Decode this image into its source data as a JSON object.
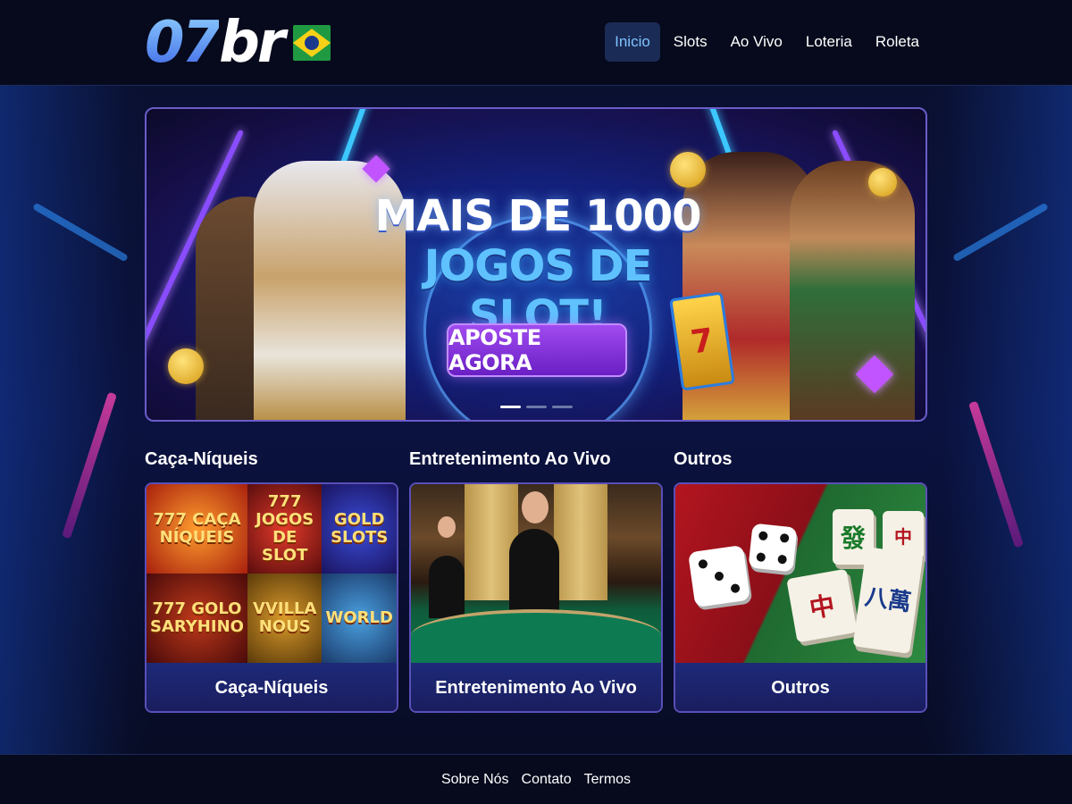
{
  "header": {
    "logo": {
      "part1": "07",
      "part2": "br"
    },
    "nav": [
      {
        "label": "Inicio",
        "active": true
      },
      {
        "label": "Slots",
        "active": false
      },
      {
        "label": "Ao Vivo",
        "active": false
      },
      {
        "label": "Loteria",
        "active": false
      },
      {
        "label": "Roleta",
        "active": false
      }
    ]
  },
  "hero": {
    "line1": "MAIS DE 1000",
    "line2": "JOGOS DE SLOT!",
    "cta": "APOSTE AGORA",
    "slot_card": "7",
    "carousel": {
      "slides": 3,
      "active_index": 0
    }
  },
  "categories": [
    {
      "heading": "Caça-Níqueis",
      "label": "Caça-Níqueis",
      "tiles": [
        "777 CAÇA NÍQUEIS",
        "777 JOGOS DE SLOT",
        "GOLD SLOTS",
        "777 GOLO SARYHINO",
        "VVILLA NOUS",
        "WORLD"
      ]
    },
    {
      "heading": "Entretenimento Ao Vivo",
      "label": "Entretenimento Ao Vivo"
    },
    {
      "heading": "Outros",
      "label": "Outros",
      "mahjong_tiles": [
        "發",
        "八萬",
        "中",
        "中"
      ]
    }
  ],
  "footer": {
    "links": [
      "Sobre Nós",
      "Contato",
      "Termos"
    ]
  },
  "colors": {
    "background": "#070b1e",
    "nav_active_bg": "#1a2b55",
    "nav_active_text": "#7fc3ff",
    "cta": "#8a36e0",
    "card_border": "#5a4fb8",
    "headline_accent": "#5fc2ff"
  }
}
